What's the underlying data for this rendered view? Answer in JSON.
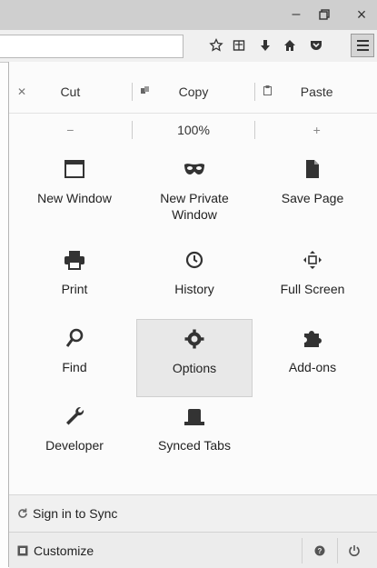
{
  "window": {
    "minimize_glyph": "–",
    "restore_glyph": "▫",
    "close_glyph": "×"
  },
  "toolbar": {
    "icons": [
      "star-icon",
      "reading-list-icon",
      "download-icon",
      "home-icon",
      "pocket-icon",
      "menu-icon"
    ]
  },
  "edit": {
    "cut_label": "Cut",
    "copy_label": "Copy",
    "paste_label": "Paste"
  },
  "zoom": {
    "minus_label": "−",
    "level_label": "100%",
    "plus_label": "+"
  },
  "menu_items": [
    {
      "label": "New Window",
      "icon": "window-icon"
    },
    {
      "label": "New Private Window",
      "icon": "mask-icon"
    },
    {
      "label": "Save Page",
      "icon": "page-icon"
    },
    {
      "label": "Print",
      "icon": "printer-icon"
    },
    {
      "label": "History",
      "icon": "clock-icon"
    },
    {
      "label": "Full Screen",
      "icon": "fullscreen-icon"
    },
    {
      "label": "Find",
      "icon": "search-icon"
    },
    {
      "label": "Options",
      "icon": "gear-icon"
    },
    {
      "label": "Add-ons",
      "icon": "puzzle-icon"
    },
    {
      "label": "Developer",
      "icon": "wrench-icon"
    },
    {
      "label": "Synced Tabs",
      "icon": "synced-tabs-icon"
    }
  ],
  "footer": {
    "sync_label": "Sign in to Sync",
    "customize_label": "Customize"
  },
  "colors": {
    "titlebar": "#cfcfcf",
    "panel": "#fbfbfb",
    "active_cell": "#e8e8e8"
  }
}
